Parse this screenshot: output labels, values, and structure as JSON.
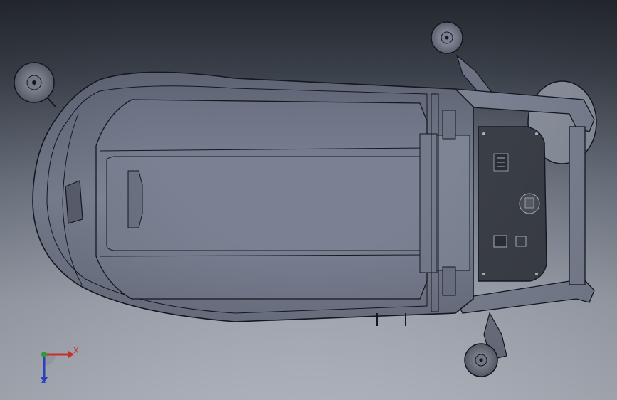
{
  "viewport": {
    "background_top": "#24282f",
    "background_bottom": "#b9bec8"
  },
  "model": {
    "body_color": "#707788",
    "edge_color": "#141821",
    "panel_color": "#3b3f47"
  },
  "triad": {
    "x_label": "X",
    "z_label": "Z",
    "x_color": "#c8302a",
    "y_color": "#2f9a3a",
    "z_color": "#2c3fbf"
  }
}
